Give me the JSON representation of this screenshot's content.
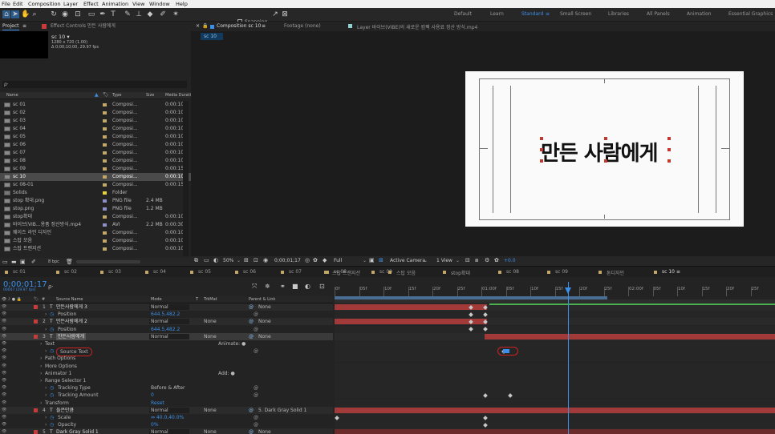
{
  "menu": [
    "File",
    "Edit",
    "Composition",
    "Layer",
    "Effect",
    "Animation",
    "View",
    "Window",
    "Help"
  ],
  "toolbar": {
    "snapping": "Snapping"
  },
  "workspaces": [
    "Default",
    "Learn",
    "Standard",
    "Small Screen",
    "Libraries",
    "All Panels",
    "Animation",
    "Essential Graphics"
  ],
  "project": {
    "tab": "Project",
    "tab_effects": "Effect Controls 만든 사람에게",
    "comp_name": "sc 10 ▾",
    "comp_info1": "1280 x 720 (1.00)",
    "comp_info2": "Δ 0;00;10;00, 29.97 fps",
    "search_placeholder": "ρ·",
    "cols": {
      "name": "Name",
      "type": "Type",
      "size": "Size",
      "dur": "Media Durati"
    },
    "items": [
      {
        "name": "sc 01",
        "type": "Composi...",
        "size": "",
        "dur": "0:00:10",
        "color": "#c2a868"
      },
      {
        "name": "sc 02",
        "type": "Composi...",
        "size": "",
        "dur": "0:00:10",
        "color": "#c2a868"
      },
      {
        "name": "sc 03",
        "type": "Composi...",
        "size": "",
        "dur": "0:00:10",
        "color": "#c2a868"
      },
      {
        "name": "sc 04",
        "type": "Composi...",
        "size": "",
        "dur": "0:00:10",
        "color": "#c2a868"
      },
      {
        "name": "sc 05",
        "type": "Composi...",
        "size": "",
        "dur": "0:00:10",
        "color": "#c2a868"
      },
      {
        "name": "sc 06",
        "type": "Composi...",
        "size": "",
        "dur": "0:00:10",
        "color": "#c2a868"
      },
      {
        "name": "sc 07",
        "type": "Composi...",
        "size": "",
        "dur": "0:00:10",
        "color": "#c2a868"
      },
      {
        "name": "sc 08",
        "type": "Composi...",
        "size": "",
        "dur": "0:00:10",
        "color": "#c2a868"
      },
      {
        "name": "sc 09",
        "type": "Composi...",
        "size": "",
        "dur": "0:00:15",
        "color": "#c2a868"
      },
      {
        "name": "sc 10",
        "type": "Composi...",
        "size": "",
        "dur": "0:00:10",
        "color": "#c2a868"
      },
      {
        "name": "sc 08-01",
        "type": "Composi...",
        "size": "",
        "dur": "0:00:15",
        "color": "#c2a868"
      },
      {
        "name": "Solids",
        "type": "Folder",
        "size": "",
        "dur": "",
        "color": "#e6d23a"
      },
      {
        "name": "stop 확대.png",
        "type": "PNG file",
        "size": "2.4 MB",
        "dur": "",
        "color": "#8f8fc8"
      },
      {
        "name": "stop.png",
        "type": "PNG file",
        "size": "1.2 MB",
        "dur": "",
        "color": "#8f8fc8"
      },
      {
        "name": "stop확대",
        "type": "Composi...",
        "size": "",
        "dur": "0:00:10",
        "color": "#c2a868"
      },
      {
        "name": "바이브(VIB...용품 정산방식.mp4",
        "type": "AVI",
        "size": "2.2 MB",
        "dur": "0:00:30",
        "color": "#8f8fc8"
      },
      {
        "name": "웨이즈 라인 디자인",
        "type": "Composi...",
        "size": "",
        "dur": "0:00:10",
        "color": "#c2a868"
      },
      {
        "name": "스탑 모음",
        "type": "Composi...",
        "size": "",
        "dur": "0:00:10",
        "color": "#c2a868"
      },
      {
        "name": "스탑 트랜지션",
        "type": "Composi...",
        "size": "",
        "dur": "0:00:10",
        "color": "#c2a868"
      }
    ],
    "bpc": "8 bpc"
  },
  "viewer": {
    "tab_comp": "Composition sc 10",
    "tab_footage": "Footage (none)",
    "tab_layer": "Layer 바이브(VIBE)의 새로운 컴팩 사용료 정산 방식.mp4",
    "crumb": "sc 10",
    "canvas_text": "만든 사람에게",
    "zoom": "50%",
    "timecode": "0;00;01;17",
    "resolution": "Full",
    "camera": "Active Camera",
    "views": "1 View",
    "offset": "+0.0"
  },
  "timeline": {
    "tabs": [
      "sc 01",
      "sc 02",
      "sc 03",
      "sc 04",
      "sc 05",
      "sc 06",
      "sc 07",
      "sc 08",
      "sc 09",
      "sc 10"
    ],
    "tab_colors": [
      "#c2a868",
      "#c2a868",
      "#c2a868",
      "#c2a868",
      "#c2a868",
      "#c2a868",
      "#c2a868",
      "#c2a868",
      "#c2a868",
      "#c2a868"
    ],
    "extra_tabs": [
      "스탑 트랜지션",
      "스탑 모음",
      "stop확대",
      "sc 08",
      "sc 09",
      "톤디자인",
      "sc 10 ≡"
    ],
    "timecode": "0;00;01;17",
    "fps": "00047 (29.97 fps)",
    "cols": {
      "source": "Source Name",
      "mode": "Mode",
      "t": "T",
      "trkmat": "TrkMat",
      "parent": "Parent & Link"
    },
    "ruler": [
      "0f",
      "05f",
      "10f",
      "15f",
      "20f",
      "25f",
      "01:00f",
      "05f",
      "10f",
      "15f",
      "20f",
      "25f",
      "02:00f",
      "05f",
      "10f",
      "15f",
      "20f",
      "25f"
    ],
    "rows": [
      {
        "num": "1",
        "name": "만든사람에게 3",
        "mode": "Normal",
        "trk": "",
        "parent": "None",
        "kind": "layer"
      },
      {
        "num": "",
        "name": "Position",
        "mode": "644.5,482.2",
        "trk": "",
        "parent": "",
        "kind": "prop"
      },
      {
        "num": "2",
        "name": "만든사람에게 2",
        "mode": "Normal",
        "trk": "None",
        "parent": "None",
        "kind": "layer"
      },
      {
        "num": "",
        "name": "Position",
        "mode": "644.5,482.2",
        "trk": "",
        "parent": "",
        "kind": "prop"
      },
      {
        "num": "3",
        "name": "만든사람에게",
        "mode": "Normal",
        "trk": "None",
        "parent": "None",
        "kind": "layer"
      },
      {
        "num": "",
        "name": "Text",
        "mode": "",
        "trk": "",
        "parent": "",
        "kind": "group",
        "right": "Animate: ●"
      },
      {
        "num": "",
        "name": "Source Text",
        "mode": "",
        "trk": "",
        "parent": "",
        "kind": "prop"
      },
      {
        "num": "",
        "name": "Path Options",
        "mode": "",
        "trk": "",
        "parent": "",
        "kind": "group"
      },
      {
        "num": "",
        "name": "More Options",
        "mode": "",
        "trk": "",
        "parent": "",
        "kind": "group"
      },
      {
        "num": "",
        "name": "Animator 1",
        "mode": "",
        "trk": "",
        "parent": "",
        "kind": "group",
        "right": "Add: ●"
      },
      {
        "num": "",
        "name": "Range Selector 1",
        "mode": "",
        "trk": "",
        "parent": "",
        "kind": "group"
      },
      {
        "num": "",
        "name": "Tracking Type",
        "mode": "Before & After",
        "trk": "",
        "parent": "",
        "kind": "prop"
      },
      {
        "num": "",
        "name": "Tracking Amount",
        "mode": "0",
        "trk": "",
        "parent": "",
        "kind": "prop"
      },
      {
        "num": "",
        "name": "Transform",
        "mode": "Reset",
        "trk": "",
        "parent": "",
        "kind": "group"
      },
      {
        "num": "4",
        "name": "들은만큼",
        "mode": "Normal",
        "trk": "None",
        "parent": "5. Dark Gray Solid 1",
        "kind": "layer"
      },
      {
        "num": "",
        "name": "Scale",
        "mode": "⇔ 40.0,40.0%",
        "trk": "",
        "parent": "",
        "kind": "prop"
      },
      {
        "num": "",
        "name": "Opacity",
        "mode": "0%",
        "trk": "",
        "parent": "",
        "kind": "prop"
      },
      {
        "num": "5",
        "name": "Dark Gray Solid 1",
        "mode": "Normal",
        "trk": "None",
        "parent": "None",
        "kind": "layer"
      }
    ]
  }
}
